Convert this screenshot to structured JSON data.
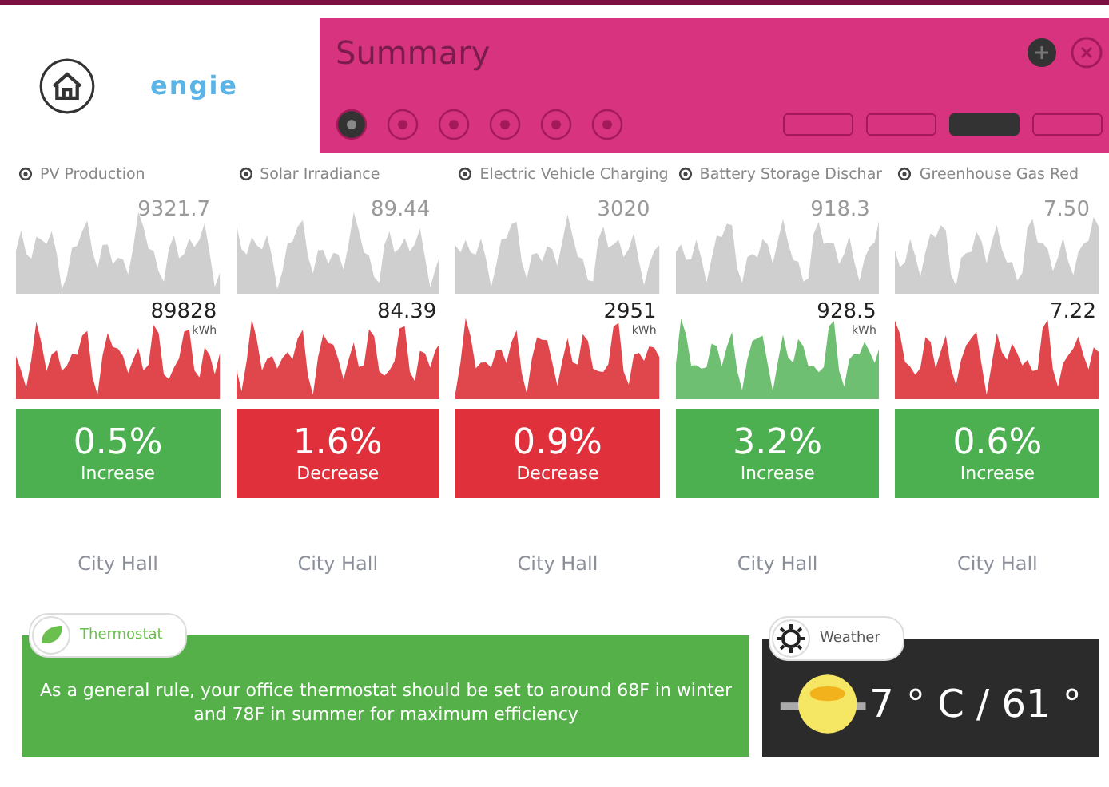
{
  "logo": {
    "text": "engie"
  },
  "header": {
    "title": "Summary",
    "view_icons": [
      {
        "selected": true
      },
      {
        "selected": false
      },
      {
        "selected": false
      },
      {
        "selected": false
      },
      {
        "selected": false
      },
      {
        "selected": false
      }
    ],
    "range_buttons": [
      {
        "selected": false
      },
      {
        "selected": false
      },
      {
        "selected": true
      },
      {
        "selected": false
      }
    ]
  },
  "metrics": [
    {
      "title": "PV Production",
      "top_value": "9321.7",
      "bottom_value": "89828",
      "bottom_unit": "kWh",
      "trend": {
        "color": "#e0474c"
      },
      "change": "0.5%",
      "direction": "Increase",
      "status": {
        "color": "#4caf50"
      },
      "site": "City Hall"
    },
    {
      "title": "Solar Irradiance",
      "top_value": "89.44",
      "bottom_value": "84.39",
      "trend": {
        "color": "#e0474c"
      },
      "change": "1.6%",
      "direction": "Decrease",
      "status": {
        "color": "#e0303c"
      },
      "site": "City Hall"
    },
    {
      "title": "Electric Vehicle Charging",
      "top_value": "3020",
      "bottom_value": "2951",
      "bottom_unit": "kWh",
      "trend": {
        "color": "#e0474c"
      },
      "change": "0.9%",
      "direction": "Decrease",
      "status": {
        "color": "#e0303c"
      },
      "site": "City Hall"
    },
    {
      "title": "Battery Storage Dischar",
      "top_value": "918.3",
      "bottom_value": "928.5",
      "bottom_unit": "kWh",
      "trend": {
        "color": "#6fbf73"
      },
      "change": "3.2%",
      "direction": "Increase",
      "status": {
        "color": "#4caf50"
      },
      "site": "City Hall"
    },
    {
      "title": "Greenhouse Gas Red",
      "top_value": "7.50",
      "bottom_value": "7.22",
      "trend": {
        "color": "#e0474c"
      },
      "change": "0.6%",
      "direction": "Increase",
      "status": {
        "color": "#4caf50"
      },
      "site": "City Hall"
    }
  ],
  "thermostat": {
    "label": "Thermostat",
    "tip": "As a general rule, your office thermostat should be set to around 68F in winter and 78F in summer for maximum efficiency"
  },
  "weather": {
    "label": "Weather",
    "reading": "7 ° C / 61 °"
  }
}
